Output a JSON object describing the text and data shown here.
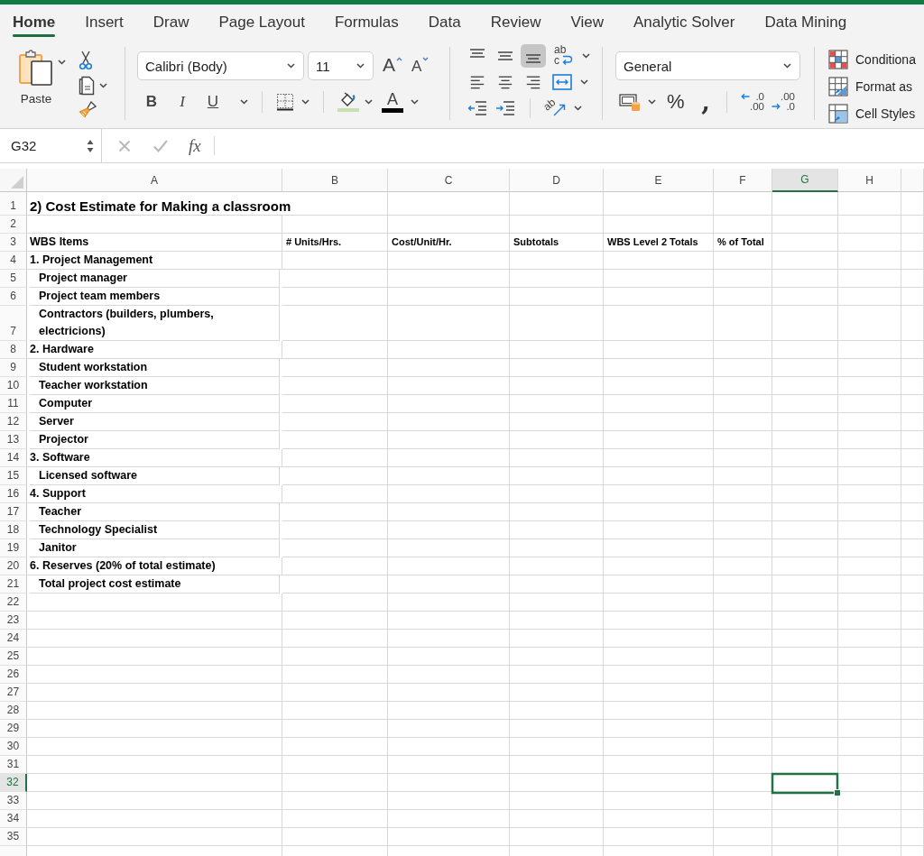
{
  "tabs": [
    {
      "label": "Home",
      "selected": true
    },
    {
      "label": "Insert",
      "selected": false
    },
    {
      "label": "Draw",
      "selected": false
    },
    {
      "label": "Page Layout",
      "selected": false
    },
    {
      "label": "Formulas",
      "selected": false
    },
    {
      "label": "Data",
      "selected": false
    },
    {
      "label": "Review",
      "selected": false
    },
    {
      "label": "View",
      "selected": false
    },
    {
      "label": "Analytic Solver",
      "selected": false
    },
    {
      "label": "Data Mining",
      "selected": false
    }
  ],
  "ribbon": {
    "clipboard": {
      "paste_label": "Paste"
    },
    "font": {
      "name": "Calibri (Body)",
      "size": "11",
      "grow_label": "A",
      "shrink_label": "A",
      "styles": [
        {
          "kind": "bold",
          "label": "B",
          "selected": false
        },
        {
          "kind": "italic",
          "label": "I",
          "selected": false
        },
        {
          "kind": "underline",
          "label": "U",
          "selected": false
        }
      ],
      "color_label": "A"
    },
    "alignment": {
      "vertical": [
        {
          "kind": "top",
          "selected": false
        },
        {
          "kind": "middle",
          "selected": false
        },
        {
          "kind": "bottom",
          "selected": true
        }
      ],
      "horizontal": [
        {
          "kind": "left",
          "selected": false
        },
        {
          "kind": "center",
          "selected": false
        },
        {
          "kind": "right",
          "selected": false
        }
      ],
      "wrap_label": [
        "ab",
        "c"
      ],
      "orientation_label": "ab"
    },
    "number": {
      "format": "General",
      "percent_label": "%",
      "comma_label": ",",
      "decimal_buttons": [
        {
          "kind": "decrease",
          "labels": [
            ".0",
            ".00"
          ]
        },
        {
          "kind": "increase",
          "labels": [
            ".00",
            ".0"
          ]
        }
      ]
    },
    "styles": [
      {
        "kind": "conditional",
        "label": "Conditiona"
      },
      {
        "kind": "table",
        "label": "Format as"
      },
      {
        "kind": "cell",
        "label": "Cell Styles"
      }
    ]
  },
  "formula_bar": {
    "name_box": "G32",
    "function_label": "fx"
  },
  "sheet": {
    "columns": [
      {
        "label": "A",
        "selected": false
      },
      {
        "label": "B",
        "selected": false
      },
      {
        "label": "C",
        "selected": false
      },
      {
        "label": "D",
        "selected": false
      },
      {
        "label": "E",
        "selected": false
      },
      {
        "label": "F",
        "selected": false
      },
      {
        "label": "G",
        "selected": true
      },
      {
        "label": "H",
        "selected": false
      }
    ],
    "rows": [
      {
        "number": "1",
        "kind": "title",
        "selected": false,
        "indented": false,
        "cells": [
          "2) Cost Estimate for Making a classroom"
        ]
      },
      {
        "number": "2",
        "kind": "empty",
        "selected": false
      },
      {
        "number": "3",
        "kind": "header",
        "selected": false,
        "indented": false,
        "cells": [
          "WBS Items",
          "# Units/Hrs.",
          "Cost/Unit/Hr.",
          "Subtotals",
          "WBS Level 2 Totals",
          "% of Total"
        ]
      },
      {
        "number": "4",
        "kind": "item",
        "selected": false,
        "indented": false,
        "cells": [
          "1. Project Management"
        ]
      },
      {
        "number": "5",
        "kind": "item",
        "selected": false,
        "indented": true,
        "cells": [
          "Project manager"
        ]
      },
      {
        "number": "6",
        "kind": "item",
        "selected": false,
        "indented": true,
        "cells": [
          "Project team members"
        ]
      },
      {
        "number": "7",
        "kind": "item",
        "selected": false,
        "indented": true,
        "cells": [
          "Contractors (builders, plumbers, electricions)"
        ]
      },
      {
        "number": "8",
        "kind": "item",
        "selected": false,
        "indented": false,
        "cells": [
          "2. Hardware"
        ]
      },
      {
        "number": "9",
        "kind": "item",
        "selected": false,
        "indented": true,
        "cells": [
          "Student workstation"
        ]
      },
      {
        "number": "10",
        "kind": "item",
        "selected": false,
        "indented": true,
        "cells": [
          "Teacher workstation"
        ]
      },
      {
        "number": "11",
        "kind": "item",
        "selected": false,
        "indented": true,
        "cells": [
          "Computer"
        ]
      },
      {
        "number": "12",
        "kind": "item",
        "selected": false,
        "indented": true,
        "cells": [
          "Server"
        ]
      },
      {
        "number": "13",
        "kind": "item",
        "selected": false,
        "indented": true,
        "cells": [
          "Projector"
        ]
      },
      {
        "number": "14",
        "kind": "item",
        "selected": false,
        "indented": false,
        "cells": [
          "3. Software"
        ]
      },
      {
        "number": "15",
        "kind": "item",
        "selected": false,
        "indented": true,
        "cells": [
          "Licensed software"
        ]
      },
      {
        "number": "16",
        "kind": "item",
        "selected": false,
        "indented": false,
        "cells": [
          "4. Support"
        ]
      },
      {
        "number": "17",
        "kind": "item",
        "selected": false,
        "indented": true,
        "cells": [
          "Teacher"
        ]
      },
      {
        "number": "18",
        "kind": "item",
        "selected": false,
        "indented": true,
        "cells": [
          "Technology Specialist"
        ]
      },
      {
        "number": "19",
        "kind": "item",
        "selected": false,
        "indented": true,
        "cells": [
          "Janitor"
        ]
      },
      {
        "number": "20",
        "kind": "item",
        "selected": false,
        "indented": false,
        "cells": [
          "6. Reserves (20% of total estimate)"
        ]
      },
      {
        "number": "21",
        "kind": "item",
        "selected": false,
        "indented": true,
        "cells": [
          "Total project cost estimate"
        ]
      },
      {
        "number": "22",
        "kind": "empty",
        "selected": false
      },
      {
        "number": "23",
        "kind": "empty",
        "selected": false
      },
      {
        "number": "24",
        "kind": "empty",
        "selected": false
      },
      {
        "number": "25",
        "kind": "empty",
        "selected": false
      },
      {
        "number": "26",
        "kind": "empty",
        "selected": false
      },
      {
        "number": "27",
        "kind": "empty",
        "selected": false
      },
      {
        "number": "28",
        "kind": "empty",
        "selected": false
      },
      {
        "number": "29",
        "kind": "empty",
        "selected": false
      },
      {
        "number": "30",
        "kind": "empty",
        "selected": false
      },
      {
        "number": "31",
        "kind": "empty",
        "selected": false
      },
      {
        "number": "32",
        "kind": "empty",
        "selected": true
      },
      {
        "number": "33",
        "kind": "empty",
        "selected": false
      },
      {
        "number": "34",
        "kind": "empty",
        "selected": false
      },
      {
        "number": "35",
        "kind": "empty",
        "selected": false
      }
    ]
  }
}
